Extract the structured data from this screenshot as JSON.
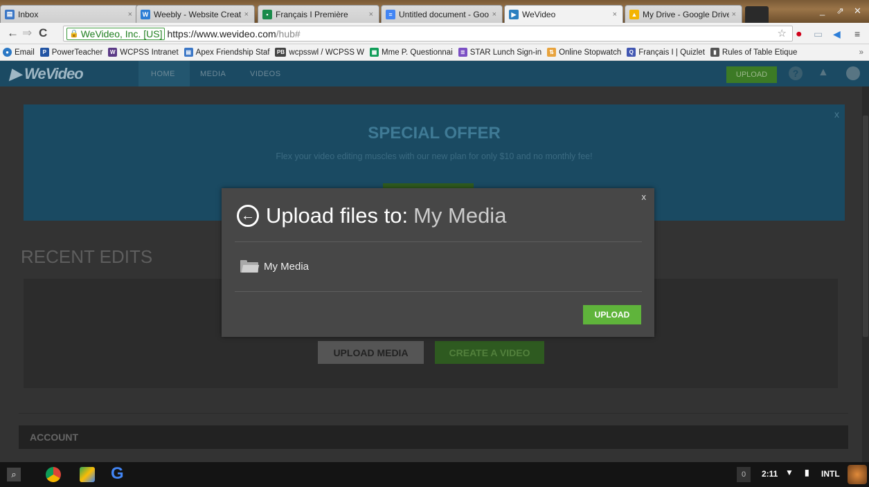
{
  "tabs": [
    {
      "title": "Inbox",
      "fav_color": "#3b77c6",
      "fav_glyph": "▤"
    },
    {
      "title": "Weebly - Website Creati",
      "fav_color": "#2c7dd5",
      "fav_glyph": "W"
    },
    {
      "title": "Français I Première",
      "fav_color": "#1a8a4a",
      "fav_glyph": "👤"
    },
    {
      "title": "Untitled document - Goo",
      "fav_color": "#4285f4",
      "fav_glyph": "≡"
    },
    {
      "title": "WeVideo",
      "fav_color": "#2a7fc0",
      "fav_glyph": "▶"
    },
    {
      "title": "My Drive - Google Drive",
      "fav_color": "#f4b400",
      "fav_glyph": "▲"
    }
  ],
  "tab_close": "×",
  "window": {
    "minimize": "_",
    "maximize": "⇗",
    "close": "✕"
  },
  "address": {
    "ev_label": "WeVideo, Inc. [US]",
    "url_host": "https://www.wevideo.com",
    "url_path": "/hub#"
  },
  "bookmarks": [
    {
      "label": "Email",
      "color": "#2b78c5",
      "glyph": "●"
    },
    {
      "label": "PowerTeacher",
      "color": "#2254a3",
      "glyph": "P"
    },
    {
      "label": "WCPSS Intranet",
      "color": "#5b3a86",
      "glyph": "W"
    },
    {
      "label": "Apex Friendship Staf",
      "color": "#3b77c6",
      "glyph": "▤"
    },
    {
      "label": "wcpsswl / WCPSS W",
      "color": "#444",
      "glyph": "PB"
    },
    {
      "label": "Mme P. Questionnai",
      "color": "#0f9d58",
      "glyph": "▦"
    },
    {
      "label": "STAR Lunch Sign-in",
      "color": "#7b4fc4",
      "glyph": "≣"
    },
    {
      "label": "Online Stopwatch",
      "color": "#e8a33d",
      "glyph": "⇅"
    },
    {
      "label": "Français I | Quizlet",
      "color": "#4257b2",
      "glyph": "Q"
    },
    {
      "label": "Rules of Table Etique",
      "color": "#555",
      "glyph": "▮"
    }
  ],
  "wevideo": {
    "logo": "▶ WeVideo",
    "nav": [
      "HOME",
      "MEDIA",
      "VIDEOS"
    ],
    "upload_btn": "UPLOAD",
    "offer_title": "SPECIAL OFFER",
    "offer_sub": "Flex your video editing muscles with our new plan for only $10 and no monthly fee!",
    "offer_close": "x",
    "recent_edits": "RECENT EDITS",
    "upload_media": "UPLOAD MEDIA",
    "create_video": "CREATE A VIDEO",
    "account": "ACCOUNT"
  },
  "modal": {
    "close": "x",
    "title_bold": "Upload files to:",
    "title_light": "My Media",
    "folder": "My Media",
    "upload_button": "UPLOAD"
  },
  "taskbar": {
    "notif_count": "0",
    "time": "2:11",
    "lang": "INTL"
  }
}
